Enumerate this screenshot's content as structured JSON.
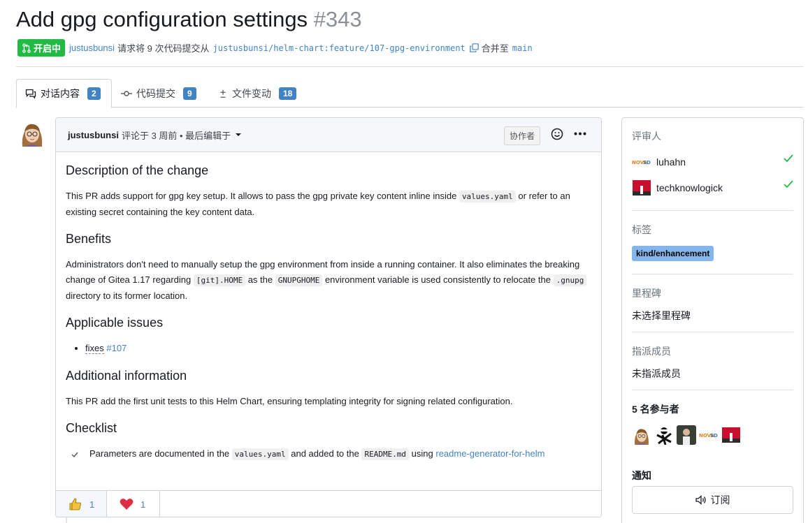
{
  "pr": {
    "title": "Add gpg configuration settings",
    "number": "#343",
    "state_label": "开启中",
    "author": "justusbunsi",
    "request_text": "请求将 9 次代码提交从",
    "source_branch": "justusbunsi/helm-chart:feature/107-gpg-environment",
    "merge_text": "合并至",
    "target_branch": "main"
  },
  "tabs": [
    {
      "label": "对话内容",
      "count": "2",
      "icon": "comments-icon"
    },
    {
      "label": "代码提交",
      "count": "9",
      "icon": "commit-icon"
    },
    {
      "label": "文件变动",
      "count": "18",
      "icon": "diff-icon"
    }
  ],
  "comment": {
    "author": "justusbunsi",
    "meta": "评论于 3 周前 • 最后编辑于",
    "role": "协作者",
    "headings": {
      "description": "Description of the change",
      "benefits": "Benefits",
      "issues": "Applicable issues",
      "additional": "Additional information",
      "checklist": "Checklist"
    },
    "description": {
      "t1": "This PR adds support for gpg key setup. It allows to pass the gpg private key content inline inside ",
      "code1": "values.yaml",
      "t2": " or refer to an existing secret containing the key content data."
    },
    "benefits": {
      "t1": "Administrators don't need to manually setup the gpg environment from inside a running container. It also eliminates the breaking change of Gitea 1.17 regarding ",
      "code1": "[git].HOME",
      "t2": " as the ",
      "code2": "GNUPGHOME",
      "t3": " environment variable is used consistently to relocate the ",
      "code3": ".gnupg",
      "t4": " directory to its former location."
    },
    "issues": {
      "fixes": "fixes",
      "link": "#107"
    },
    "additional": "This PR add the first unit tests to this Helm Chart, ensuring templating integrity for signing related configuration.",
    "checklist": {
      "t1": "Parameters are documented in the ",
      "code1": "values.yaml",
      "t2": " and added to the ",
      "code2": "README.md",
      "t3": " using ",
      "link": "readme-generator-for-helm"
    },
    "reactions": [
      {
        "emoji": "thumbs-up-icon",
        "count": "1"
      },
      {
        "emoji": "heart-icon",
        "count": "1"
      }
    ]
  },
  "sidebar": {
    "reviewers_title": "评审人",
    "reviewers": [
      {
        "name": "luhahn"
      },
      {
        "name": "techknowlogick"
      }
    ],
    "labels_title": "标签",
    "label": "kind/enhancement",
    "label_color": "#84b6eb",
    "milestone_title": "里程碑",
    "milestone_value": "未选择里程碑",
    "assignees_title": "指派成员",
    "assignees_value": "未指派成员",
    "participants_title": "5 名参与者",
    "notifications_title": "通知",
    "subscribe_label": "订阅"
  },
  "colors": {
    "accent": "#4183c4",
    "open_badge": "#21ba45",
    "approved_check": "#21ba45"
  }
}
